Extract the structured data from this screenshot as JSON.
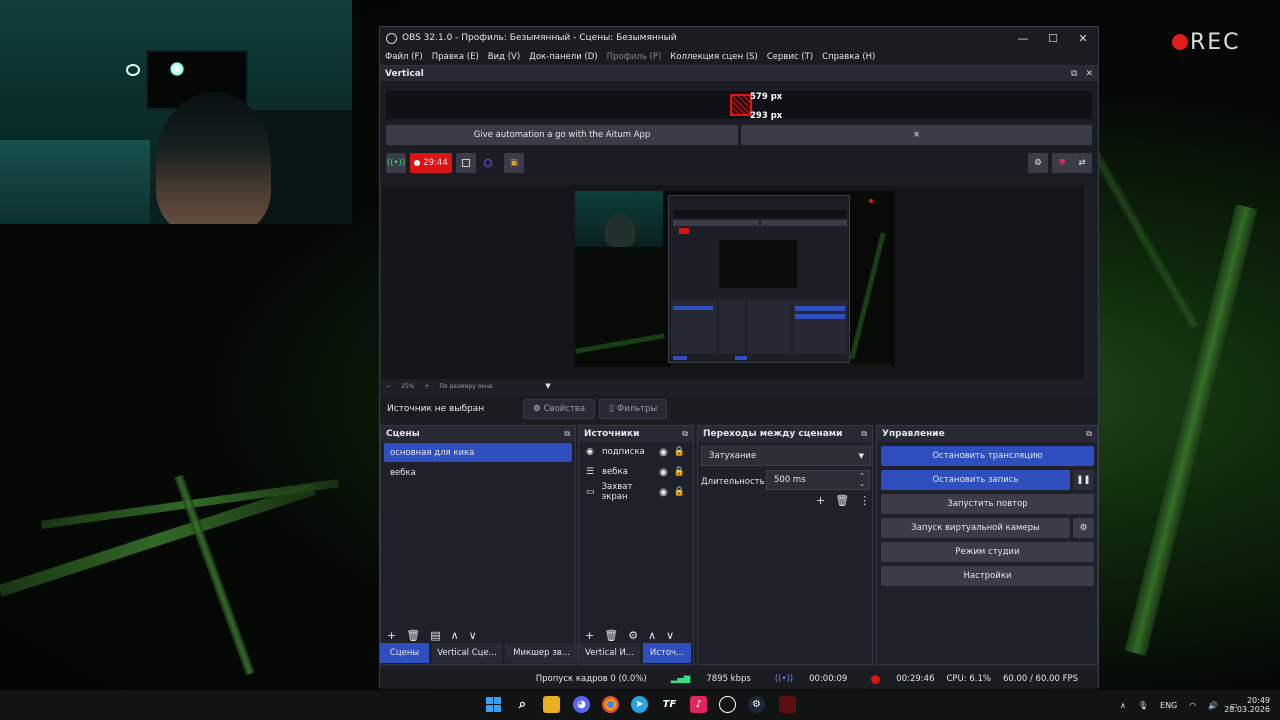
{
  "overlay": {
    "rec_label": "REC"
  },
  "window": {
    "title": "OBS 32.1.0 - Профиль: Безымянный - Сцены: Безымянный",
    "controls": [
      "—",
      "☐",
      "✕"
    ]
  },
  "menu": [
    {
      "label": "Файл (F)",
      "disabled": false
    },
    {
      "label": "Правка (E)",
      "disabled": false
    },
    {
      "label": "Вид (V)",
      "disabled": false
    },
    {
      "label": "Док-панели (D)",
      "disabled": false
    },
    {
      "label": "Профиль (P)",
      "disabled": true
    },
    {
      "label": "Коллекция сцен (S)",
      "disabled": false
    },
    {
      "label": "Сервис (T)",
      "disabled": false
    },
    {
      "label": "Справка (H)",
      "disabled": false
    }
  ],
  "vertical": {
    "title": "Vertical",
    "width_label": "579 px",
    "height_label": "293 px",
    "aitum_label": "Give automation a go with the Aitum App",
    "close_label": "×",
    "rec_time": "29:44"
  },
  "preview": {
    "zoom": "25%",
    "fit_label": "По размеру окна"
  },
  "source_bar": {
    "no_source": "Источник не выбран",
    "properties": "Свойства",
    "filters": "Фильтры"
  },
  "scenes": {
    "title": "Сцены",
    "items": [
      {
        "label": "основная для кика",
        "selected": true
      },
      {
        "label": "вебка",
        "selected": false
      }
    ]
  },
  "sources": {
    "title": "Источники",
    "items": [
      {
        "label": "подписка",
        "icon": "browser-icon"
      },
      {
        "label": "вебка",
        "icon": "list-icon"
      },
      {
        "label": "Захват экран",
        "icon": "monitor-icon"
      }
    ]
  },
  "transitions": {
    "title": "Переходы между сценами",
    "selected": "Затухание",
    "duration_label": "Длительность",
    "duration_value": "500 ms"
  },
  "controls": {
    "title": "Управление",
    "stop_stream": "Остановить трансляцию",
    "stop_record": "Остановить запись",
    "replay": "Запустить повтор",
    "virtual_cam": "Запуск виртуальной камеры",
    "studio_mode": "Режим студии",
    "settings": "Настройки"
  },
  "bottom_tabs_left": [
    {
      "label": "Сцены",
      "active": true
    },
    {
      "label": "Vertical Сце...",
      "active": false
    },
    {
      "label": "Микшер зв...",
      "active": false
    }
  ],
  "bottom_tabs_right": [
    {
      "label": "Vertical И...",
      "active": false
    },
    {
      "label": "Источ...",
      "active": true
    }
  ],
  "status": {
    "dropped": "Пропуск кадров 0 (0.0%)",
    "bitrate": "7895 kbps",
    "stream_time": "00:00:09",
    "rec_time": "00:29:46",
    "cpu": "CPU: 6.1%",
    "fps": "60.00 / 60.00 FPS"
  },
  "taskbar": {
    "lang": "ENG",
    "time": "20:49",
    "date": "28.03.2026"
  },
  "colors": {
    "accent": "#2f4fbe",
    "record_red": "#e01616"
  }
}
